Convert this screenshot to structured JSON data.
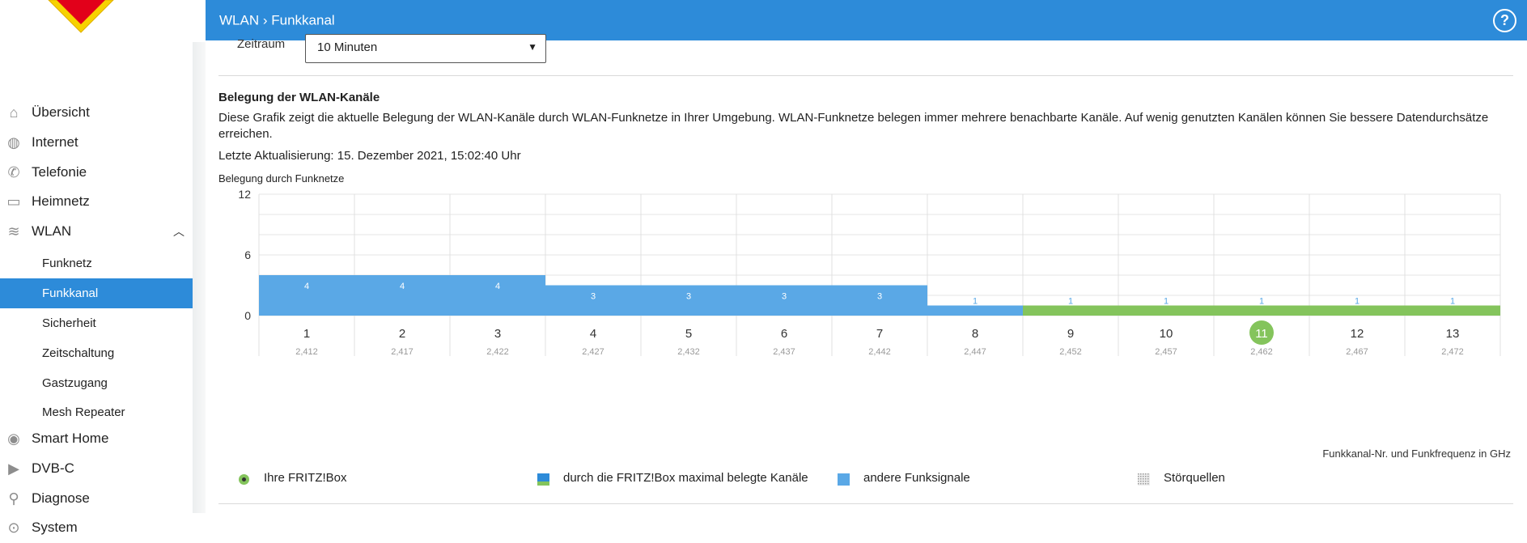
{
  "header": {
    "crumb_parent": "WLAN",
    "crumb_sep": "›",
    "crumb_current": "Funkkanal",
    "help_label": "?"
  },
  "sidebar": {
    "items": [
      {
        "label": "Übersicht",
        "icon": "home-icon"
      },
      {
        "label": "Internet",
        "icon": "globe-icon"
      },
      {
        "label": "Telefonie",
        "icon": "phone-icon"
      },
      {
        "label": "Heimnetz",
        "icon": "network-icon"
      },
      {
        "label": "WLAN",
        "icon": "wifi-icon"
      }
    ],
    "wlan_sub": [
      {
        "label": "Funknetz"
      },
      {
        "label": "Funkkanal"
      },
      {
        "label": "Sicherheit"
      },
      {
        "label": "Zeitschaltung"
      },
      {
        "label": "Gastzugang"
      },
      {
        "label": "Mesh Repeater"
      }
    ],
    "items_after": [
      {
        "label": "Smart Home",
        "icon": "smart-home-icon"
      },
      {
        "label": "DVB-C",
        "icon": "tv-icon"
      },
      {
        "label": "Diagnose",
        "icon": "diagnose-icon"
      },
      {
        "label": "System",
        "icon": "system-icon"
      }
    ],
    "active_item": "Funkkanal"
  },
  "form": {
    "zeitraum_label": "Zeitraum",
    "zeitraum_value": "10 Minuten"
  },
  "section": {
    "title": "Belegung der WLAN-Kanäle",
    "description": "Diese Grafik zeigt die aktuelle Belegung der WLAN-Kanäle durch WLAN-Funknetze in Ihrer Umgebung. WLAN-Funknetze belegen immer mehrere benachbarte Kanäle. Auf wenig genutzten Kanälen können Sie bessere Datendurchsätze erreichen.",
    "updated": "Letzte Aktualisierung: 15. Dezember 2021, 15:02:40 Uhr",
    "chart_caption": "Belegung durch Funknetze",
    "axis_note": "Funkkanal-Nr. und Funkfrequenz in GHz"
  },
  "legend": {
    "own_box": "Ihre FRITZ!Box",
    "max_channels": "durch die FRITZ!Box maximal belegte Kanäle",
    "other_signals": "andere Funksignale",
    "interference": "Störquellen"
  },
  "colors": {
    "accent": "#2d8bd9",
    "other_signals": "#5aa8e6",
    "fritz_channels": "#84c45c",
    "current_channel": "#84c45c"
  },
  "chart_data": {
    "type": "bar",
    "title": "Belegung durch Funknetze",
    "categories": [
      "1",
      "2",
      "3",
      "4",
      "5",
      "6",
      "7",
      "8",
      "9",
      "10",
      "11",
      "12",
      "13"
    ],
    "frequencies": [
      "2,412",
      "2,417",
      "2,422",
      "2,427",
      "2,432",
      "2,437",
      "2,442",
      "2,447",
      "2,452",
      "2,457",
      "2,462",
      "2,467",
      "2,472"
    ],
    "series": [
      {
        "name": "andere Funksignale",
        "values": [
          4,
          4,
          4,
          3,
          3,
          3,
          3,
          1,
          1,
          1,
          1,
          1,
          1
        ]
      }
    ],
    "fritz_channels": [
      9,
      10,
      11,
      12,
      13
    ],
    "current_channel": 11,
    "ylim": [
      0,
      12
    ],
    "yticks": [
      0,
      6,
      12
    ],
    "grid": true
  }
}
